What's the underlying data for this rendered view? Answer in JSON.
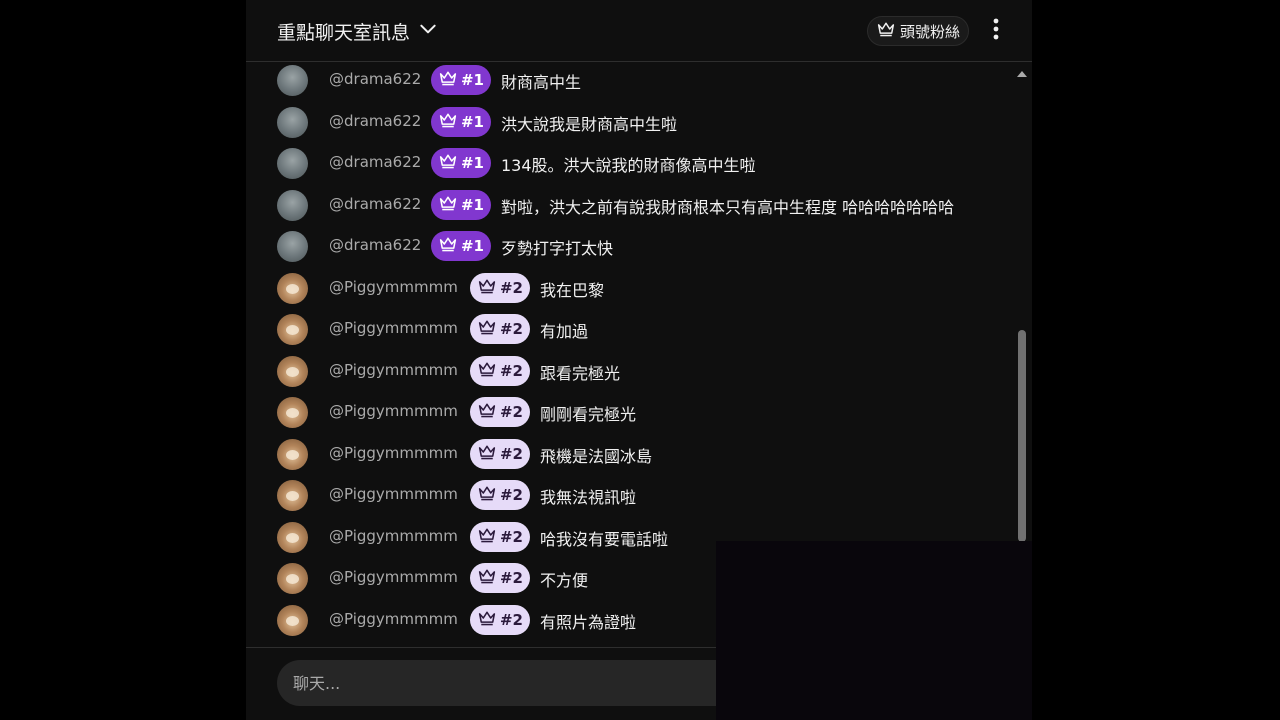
{
  "header": {
    "title": "重點聊天室訊息",
    "chip_label": "頭號粉絲",
    "more_icon": "more-vert-icon"
  },
  "colors": {
    "panel_bg": "#0f0f0f",
    "badge_rank1": "#8137cf",
    "badge_rank2": "#e6dbf8"
  },
  "messages": [
    {
      "author": "@drama622",
      "badge": "#1",
      "text": "財商高中生"
    },
    {
      "author": "@drama622",
      "badge": "#1",
      "text": "洪大說我是財商高中生啦"
    },
    {
      "author": "@drama622",
      "badge": "#1",
      "text": "134股。洪大說我的財商像高中生啦"
    },
    {
      "author": "@drama622",
      "badge": "#1",
      "text": "對啦，洪大之前有說我財商根本只有高中生程度 哈哈哈哈哈哈哈"
    },
    {
      "author": "@drama622",
      "badge": "#1",
      "text": "歹勢打字打太快"
    },
    {
      "author": "@Piggymmmmm",
      "badge": "#2",
      "text": "我在巴黎"
    },
    {
      "author": "@Piggymmmmm",
      "badge": "#2",
      "text": "有加過"
    },
    {
      "author": "@Piggymmmmm",
      "badge": "#2",
      "text": "跟看完極光"
    },
    {
      "author": "@Piggymmmmm",
      "badge": "#2",
      "text": "剛剛看完極光"
    },
    {
      "author": "@Piggymmmmm",
      "badge": "#2",
      "text": "飛機是法國冰島"
    },
    {
      "author": "@Piggymmmmm",
      "badge": "#2",
      "text": "我無法視訊啦"
    },
    {
      "author": "@Piggymmmmm",
      "badge": "#2",
      "text": "哈我沒有要電話啦"
    },
    {
      "author": "@Piggymmmmm",
      "badge": "#2",
      "text": "不方便"
    },
    {
      "author": "@Piggymmmmm",
      "badge": "#2",
      "text": "有照片為證啦"
    }
  ],
  "footer": {
    "placeholder": "聊天..."
  }
}
